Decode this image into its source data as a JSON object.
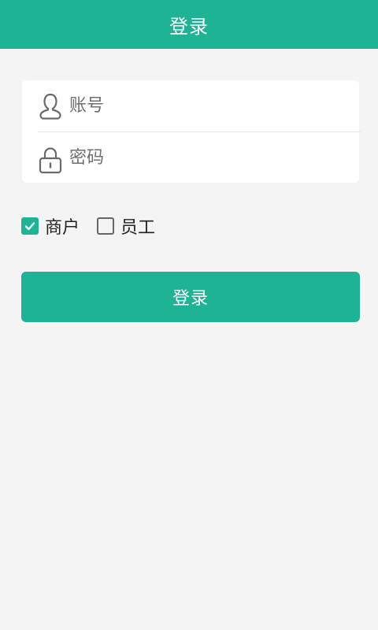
{
  "header": {
    "title": "登录"
  },
  "form": {
    "account": {
      "placeholder": "账号",
      "value": "",
      "icon": "user-icon"
    },
    "password": {
      "placeholder": "密码",
      "value": "",
      "icon": "lock-icon"
    }
  },
  "roles": [
    {
      "label": "商户",
      "checked": true
    },
    {
      "label": "员工",
      "checked": false
    }
  ],
  "login_button": {
    "label": "登录"
  },
  "colors": {
    "accent": "#1db394",
    "background": "#f4f4f4",
    "card": "#ffffff",
    "icon": "#666666"
  }
}
